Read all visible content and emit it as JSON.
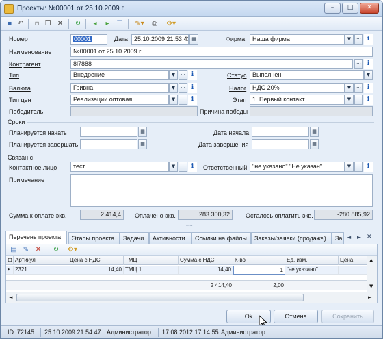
{
  "window": {
    "title": "Проекты: №00001 от 25.10.2009 г.",
    "minimize": "–",
    "maximize": "□",
    "close": "✕"
  },
  "toolbar": {
    "icons": [
      "save-icon",
      "undo-icon",
      "new-icon",
      "copy-icon",
      "delete-icon",
      "refresh-icon",
      "back-icon",
      "forward-icon",
      "list-icon",
      "edit-menu-icon",
      "print-icon",
      "settings-menu-icon"
    ]
  },
  "form": {
    "nomer_label": "Номер",
    "nomer_value": "00001",
    "data_label": "Дата",
    "data_value": "25.10.2009 21:53:43",
    "firma_label": "Фирма",
    "firma_value": "Наша фирма",
    "naim_label": "Наименование",
    "naim_value": "№00001 от 25.10.2009 г.",
    "kontragent_label": "Контрагент",
    "kontragent_value": "8i7888",
    "tip_label": "Тип",
    "tip_value": "Внедрение",
    "status_label": "Статус",
    "status_value": "Выполнен",
    "valuta_label": "Валюта",
    "valuta_value": "Гривна",
    "nalog_label": "Налог",
    "nalog_value": "НДС 20%",
    "tipcen_label": "Тип цен",
    "tipcen_value": "Реализации оптовая",
    "etap_label": "Этап",
    "etap_value": "1. Первый контакт",
    "pobeditel_label": "Победитель",
    "prichina_label": "Причина победы",
    "sroki_title": "Сроки",
    "plan_start_label": "Планируется начать",
    "plan_end_label": "Планируется завершать",
    "date_start_label": "Дата начала",
    "date_end_label": "Дата завершения",
    "svyazan_title": "Связан с",
    "kontakt_label": "Контактное лицо",
    "kontakt_value": "тест",
    "otvetstv_label": "Ответственный",
    "otvetstv_value": "\"не указано\" \"Не указан\"",
    "primechanie_label": "Примечание",
    "summa_label": "Сумма к оплате экв.",
    "summa_value": "2 414,4",
    "oplacheno_label": "Оплачено экв.",
    "oplacheno_value": "283 300,32",
    "ostalos_label": "Осталось оплатить экв.",
    "ostalos_value": "-280 885,92",
    "splitter_dots": "....."
  },
  "tabs": [
    "Перечень проекта",
    "Этапы проекта",
    "Задачи",
    "Активности",
    "Ссылки на файлы",
    "Заказы/заявки (продажа)",
    "За"
  ],
  "grid": {
    "columns": [
      "Артикул",
      "Цена с НДС",
      "ТМЦ",
      "Сумма с НДС",
      "К-во",
      "Ед. изм.",
      "Цена"
    ],
    "rows": [
      [
        "2321",
        "14,40",
        "ТМЦ 1",
        "14,40",
        "1",
        "\"не указано\"",
        ""
      ]
    ],
    "totals": {
      "sum": "2 414,40",
      "qty": "2,00"
    }
  },
  "buttons": {
    "ok": "Ok",
    "cancel": "Отмена",
    "save": "Сохранить"
  },
  "status": {
    "id": "ID: 72145",
    "created": "25.10.2009 21:54:47",
    "author": "Администратор",
    "modified": "17.08.2012 17:14:55",
    "modifier": "Администратор"
  }
}
